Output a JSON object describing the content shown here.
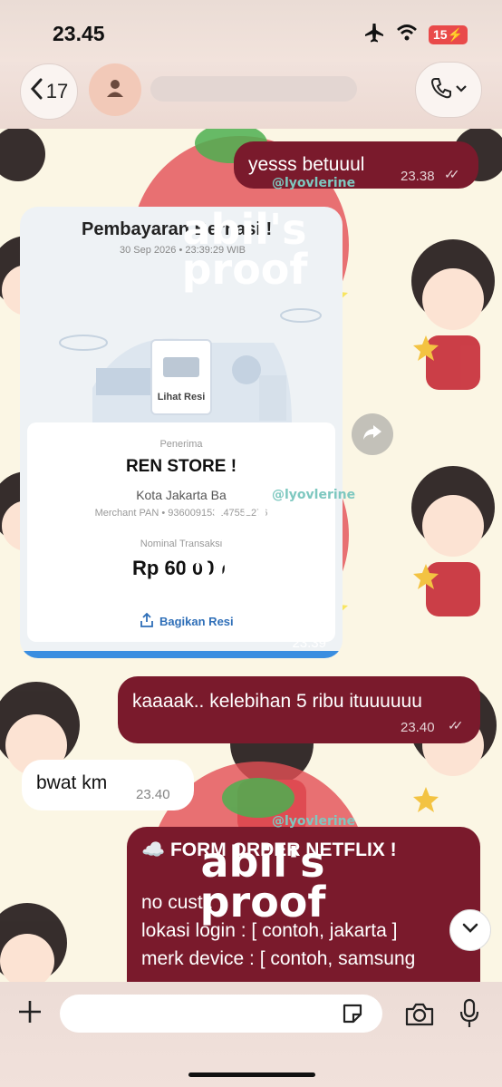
{
  "status_bar": {
    "time": "23.45",
    "battery": "15"
  },
  "header": {
    "back_count": "17"
  },
  "messages": [
    {
      "text": "yesss betuuul",
      "time": "23.38"
    },
    {
      "text": "kaaaak.. kelebihan 5 ribu ituuuuuu",
      "time": "23.40"
    },
    {
      "text": "bwat km",
      "time": "23.40"
    }
  ],
  "receipt": {
    "title": "Pembayaran Berhasil!",
    "date": "30 Sep 2026 • 23:39:29 WIB",
    "lihat_resi": "Lihat Resi",
    "recipient_label": "Penerima",
    "store": "REN STORE !",
    "city": "Kota Jakarta Ba",
    "merchant": "Merchant PAN • 936009153147551276",
    "amount_label": "Nominal Transaksi",
    "amount": "Rp 60.000",
    "share_label": "Bagikan Resi",
    "time": "23.39"
  },
  "form_message": {
    "title": "☁️ FORM ORDER NETFLIX !",
    "lines": [
      "no cust :",
      "lokasi login : [ contoh, jakarta ]",
      "merk device : [ contoh, samsung"
    ]
  },
  "watermark": {
    "line1": "abil's",
    "line2": "proof",
    "tag": "@lyovlerine"
  },
  "colors": {
    "outgoing_bubble": "#7a1a2c",
    "accent": "#2f6fb8"
  }
}
